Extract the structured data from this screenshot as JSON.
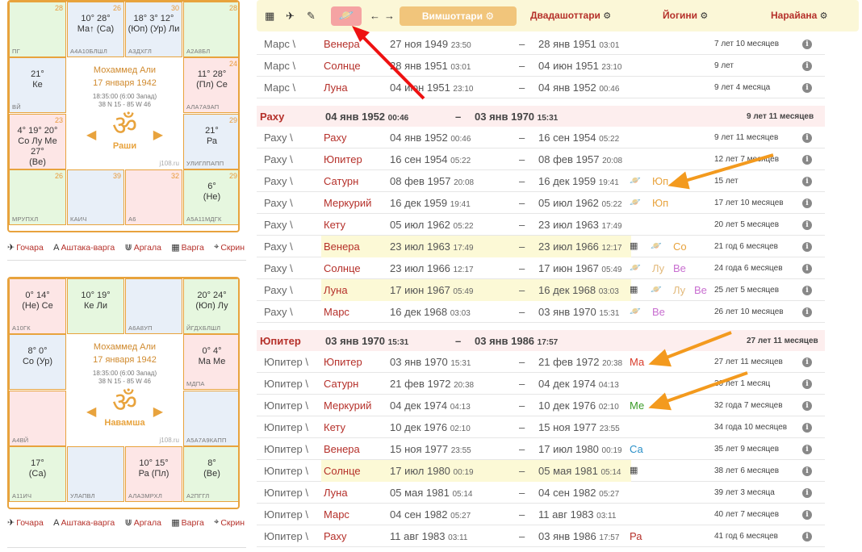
{
  "chart1": {
    "name": "Мохаммед Али",
    "date": "17 января 1942",
    "time": "18:35:00 (6:00 Запад)",
    "coords": "38 N 15 - 85 W 46",
    "om": "ॐ",
    "label": "Раши",
    "site": "j108.ru",
    "cells": [
      {
        "num": "28",
        "bot": "ПГ",
        "pl": ""
      },
      {
        "num": "26",
        "bot": "А4А10БЛШЛ",
        "pl": "10° 28°\nМа↑ (Са)"
      },
      {
        "num": "30",
        "bot": "А3ДХГЛ",
        "pl": "18° 3° 12°\n(Юп) (Ур) Ли"
      },
      {
        "num": "28",
        "bot": "А2А8БЛ",
        "pl": ""
      },
      {
        "num": "24",
        "bot": "АЛА7А9АП",
        "pl": "11° 28°\n(Пл) Се"
      },
      {
        "num": "29",
        "bot": "УЛИГЛПАПП",
        "pl": "21°\nРа"
      },
      {
        "num": "29",
        "bot": "А5А11МДГК",
        "pl": "6°\n(Не)"
      },
      {
        "num": "32",
        "bot": "А6",
        "pl": ""
      },
      {
        "num": "39",
        "bot": "КАИЧ",
        "pl": ""
      },
      {
        "num": "26",
        "bot": "МРУПХЛ",
        "pl": ""
      },
      {
        "num": "23",
        "bot": "",
        "pl": "4° 19° 20°\nСо Лу Ме\n27°\n(Ве)"
      },
      {
        "num": "",
        "bot": "ВЙ",
        "pl": "21°\nКе"
      }
    ]
  },
  "chart2": {
    "name": "Мохаммед Али",
    "date": "17 января 1942",
    "time": "18:35:00 (6:00 Запад)",
    "coords": "38 N 15 - 85 W 46",
    "om": "ॐ",
    "label": "Навамша",
    "site": "j108.ru",
    "cells": [
      {
        "bot": "А10ГК",
        "pl": "0° 14°\n(Не) Се"
      },
      {
        "bot": "",
        "pl": "10° 19°\nКе Ли"
      },
      {
        "bot": "А6А8УП",
        "pl": ""
      },
      {
        "bot": "ЙГДХБЛШЛ",
        "pl": "20° 24°\n(Юп) Лу"
      },
      {
        "bot": "МДПА",
        "pl": "0° 4°\nМа Ме"
      },
      {
        "bot": "А5А7А9КАПП",
        "pl": ""
      },
      {
        "bot": "А2ПГГЛ",
        "pl": "8°\n(Ве)"
      },
      {
        "bot": "АЛАЗМРХЛ",
        "pl": "10° 15°\nРа (Пл)"
      },
      {
        "bot": "УЛАПВЛ",
        "pl": ""
      },
      {
        "bot": "А11ИЧ",
        "pl": "17°\n(Са)"
      },
      {
        "bot": "А4ВЙ",
        "pl": ""
      },
      {
        "bot": "",
        "pl": "8° 0°\nСо (Ур)"
      }
    ]
  },
  "chart_links": [
    "Гочара",
    "Аштака-варга",
    "Аргала",
    "Варга",
    "Скрин"
  ],
  "toolbar": {
    "vimshottari": "Вимшоттари",
    "tabs": [
      "Двадашоттари",
      "Йогини",
      "Нарайана"
    ]
  },
  "rows": [
    {
      "type": "row",
      "a": "Марс \\",
      "b": "Венера",
      "sd": "27 ноя 1949",
      "st": "23:50",
      "ed": "28 янв 1951",
      "et": "03:01",
      "dur": "7 лет 10 месяцев"
    },
    {
      "type": "row",
      "a": "Марс \\",
      "b": "Солнце",
      "sd": "28 янв 1951",
      "st": "03:01",
      "ed": "04 июн 1951",
      "et": "23:10",
      "dur": "9 лет"
    },
    {
      "type": "row",
      "a": "Марс \\",
      "b": "Луна",
      "sd": "04 июн 1951",
      "st": "23:10",
      "ed": "04 янв 1952",
      "et": "00:46",
      "dur": "9 лет 4 месяца"
    },
    {
      "type": "hdr",
      "a": "Раху",
      "sd": "04 янв 1952",
      "st": "00:46",
      "ed": "03 янв 1970",
      "et": "15:31",
      "dur": "9 лет 11 месяцев"
    },
    {
      "type": "row",
      "a": "Раху \\",
      "b": "Раху",
      "sd": "04 янв 1952",
      "st": "00:46",
      "ed": "16 сен 1954",
      "et": "05:22",
      "dur": "9 лет 11 месяцев"
    },
    {
      "type": "row",
      "a": "Раху \\",
      "b": "Юпитер",
      "sd": "16 сен 1954",
      "st": "05:22",
      "ed": "08 фев 1957",
      "et": "20:08",
      "dur": "12 лет 7 месяцев"
    },
    {
      "type": "row",
      "a": "Раху \\",
      "b": "Сатурн",
      "sd": "08 фев 1957",
      "st": "20:08",
      "ed": "16 дек 1959",
      "et": "19:41",
      "dur": "15 лет",
      "extra": [
        "sat",
        "Юп"
      ]
    },
    {
      "type": "row",
      "a": "Раху \\",
      "b": "Меркурий",
      "sd": "16 дек 1959",
      "st": "19:41",
      "ed": "05 июл 1962",
      "et": "05:22",
      "dur": "17 лет 10 месяцев",
      "extra": [
        "sat",
        "Юп"
      ]
    },
    {
      "type": "row",
      "a": "Раху \\",
      "b": "Кету",
      "sd": "05 июл 1962",
      "st": "05:22",
      "ed": "23 июл 1963",
      "et": "17:49",
      "dur": "20 лет 5 месяцев"
    },
    {
      "type": "row",
      "a": "Раху \\",
      "b": "Венера",
      "sd": "23 июл 1963",
      "st": "17:49",
      "ed": "23 июл 1966",
      "et": "12:17",
      "dur": "21 год 6 месяцев",
      "hl": true,
      "extra": [
        "cal",
        "sat",
        "Со"
      ]
    },
    {
      "type": "row",
      "a": "Раху \\",
      "b": "Солнце",
      "sd": "23 июл 1966",
      "st": "12:17",
      "ed": "17 июн 1967",
      "et": "05:49",
      "dur": "24 года 6 месяцев",
      "extra": [
        "sat",
        "Лу",
        "Ве"
      ]
    },
    {
      "type": "row",
      "a": "Раху \\",
      "b": "Луна",
      "sd": "17 июн 1967",
      "st": "05:49",
      "ed": "16 дек 1968",
      "et": "03:03",
      "dur": "25 лет 5 месяцев",
      "hl": true,
      "extra": [
        "cal",
        "sat",
        "Лу",
        "Ве"
      ]
    },
    {
      "type": "row",
      "a": "Раху \\",
      "b": "Марс",
      "sd": "16 дек 1968",
      "st": "03:03",
      "ed": "03 янв 1970",
      "et": "15:31",
      "dur": "26 лет 10 месяцев",
      "extra": [
        "sat",
        "Ве"
      ]
    },
    {
      "type": "hdr",
      "a": "Юпитер",
      "sd": "03 янв 1970",
      "st": "15:31",
      "ed": "03 янв 1986",
      "et": "17:57",
      "dur": "27 лет 11 месяцев"
    },
    {
      "type": "row",
      "a": "Юпитер \\",
      "b": "Юпитер",
      "sd": "03 янв 1970",
      "st": "15:31",
      "ed": "21 фев 1972",
      "et": "20:38",
      "dur": "27 лет 11 месяцев",
      "extra": [
        "Ма"
      ]
    },
    {
      "type": "row",
      "a": "Юпитер \\",
      "b": "Сатурн",
      "sd": "21 фев 1972",
      "st": "20:38",
      "ed": "04 дек 1974",
      "et": "04:13",
      "dur": "30 лет 1 месяц"
    },
    {
      "type": "row",
      "a": "Юпитер \\",
      "b": "Меркурий",
      "sd": "04 дек 1974",
      "st": "04:13",
      "ed": "10 дек 1976",
      "et": "02:10",
      "dur": "32 года 7 месяцев",
      "extra": [
        "Ме"
      ]
    },
    {
      "type": "row",
      "a": "Юпитер \\",
      "b": "Кету",
      "sd": "10 дек 1976",
      "st": "02:10",
      "ed": "15 ноя 1977",
      "et": "23:55",
      "dur": "34 года 10 месяцев"
    },
    {
      "type": "row",
      "a": "Юпитер \\",
      "b": "Венера",
      "sd": "15 ноя 1977",
      "st": "23:55",
      "ed": "17 июл 1980",
      "et": "00:19",
      "dur": "35 лет 9 месяцев",
      "extra": [
        "Са"
      ]
    },
    {
      "type": "row",
      "a": "Юпитер \\",
      "b": "Солнце",
      "sd": "17 июл 1980",
      "st": "00:19",
      "ed": "05 мая 1981",
      "et": "05:14",
      "dur": "38 лет 6 месяцев",
      "hl": true,
      "extra": [
        "cal"
      ]
    },
    {
      "type": "row",
      "a": "Юпитер \\",
      "b": "Луна",
      "sd": "05 мая 1981",
      "st": "05:14",
      "ed": "04 сен 1982",
      "et": "05:27",
      "dur": "39 лет 3 месяца"
    },
    {
      "type": "row",
      "a": "Юпитер \\",
      "b": "Марс",
      "sd": "04 сен 1982",
      "st": "05:27",
      "ed": "11 авг 1983",
      "et": "03:11",
      "dur": "40 лет 7 месяцев"
    },
    {
      "type": "row",
      "a": "Юпитер \\",
      "b": "Раху",
      "sd": "11 авг 1983",
      "st": "03:11",
      "ed": "03 янв 1986",
      "et": "17:57",
      "dur": "41 год 6 месяцев",
      "extra": [
        "Ра"
      ]
    }
  ]
}
